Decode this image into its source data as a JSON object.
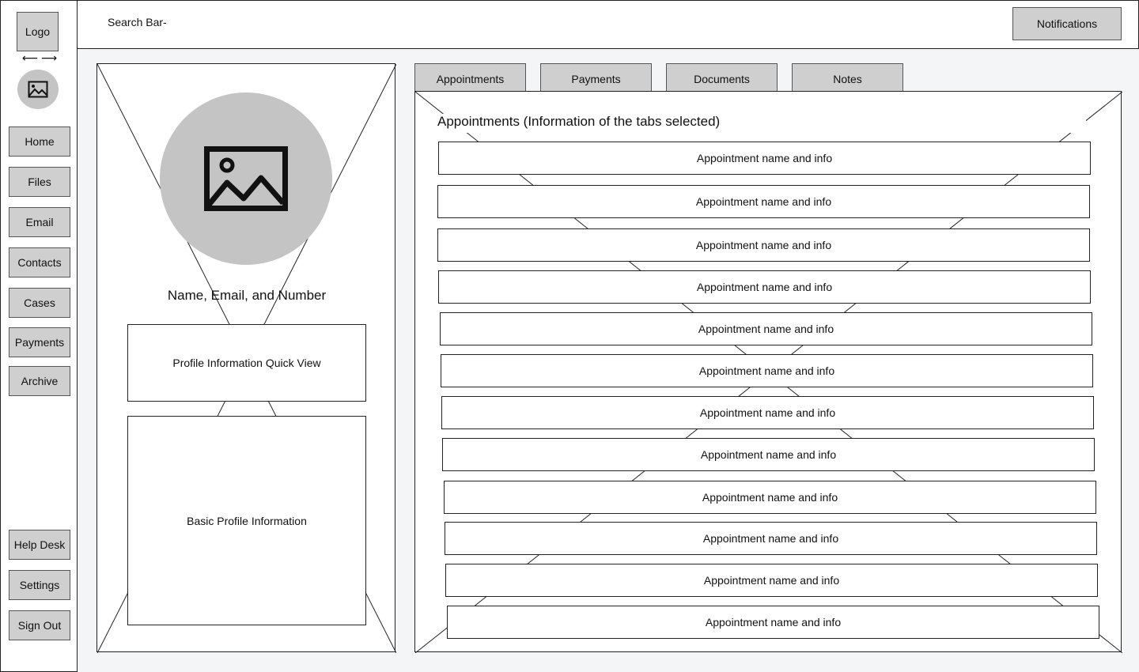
{
  "sidebar": {
    "logo_label": "Logo",
    "arrows_label": "⟵  ⟶",
    "avatar_icon": "image-icon",
    "nav_items": [
      {
        "label": "Home"
      },
      {
        "label": "Files"
      },
      {
        "label": "Email"
      },
      {
        "label": "Contacts"
      },
      {
        "label": "Cases"
      },
      {
        "label": "Payments"
      },
      {
        "label": "Archive"
      }
    ],
    "bottom_items": [
      {
        "label": "Help Desk"
      },
      {
        "label": "Settings"
      },
      {
        "label": "Sign Out"
      }
    ]
  },
  "header": {
    "search_label": "Search Bar-",
    "notifications_label": "Notifications"
  },
  "profile": {
    "photo_icon": "image-icon",
    "name_line": "Name, Email, and Number",
    "quick_view_label": "Profile Information Quick View",
    "basic_info_label": "Basic Profile Information"
  },
  "tabs": [
    {
      "label": "Appointments"
    },
    {
      "label": "Payments"
    },
    {
      "label": "Documents"
    },
    {
      "label": "Notes"
    }
  ],
  "content": {
    "heading": "Appointments (Information of the tabs selected)",
    "appointments": [
      "Appointment name and info",
      "Appointment name and info",
      "Appointment name and info",
      "Appointment name and info",
      "Appointment name and info",
      "Appointment name and info",
      "Appointment name and info",
      "Appointment name and info",
      "Appointment name and info",
      "Appointment name and info",
      "Appointment name and info",
      "Appointment name and info"
    ]
  },
  "colors": {
    "background": "#f4f5f7",
    "button_fill": "#cfcfcf",
    "avatar_fill": "#c4c4c4",
    "border": "#222222"
  }
}
